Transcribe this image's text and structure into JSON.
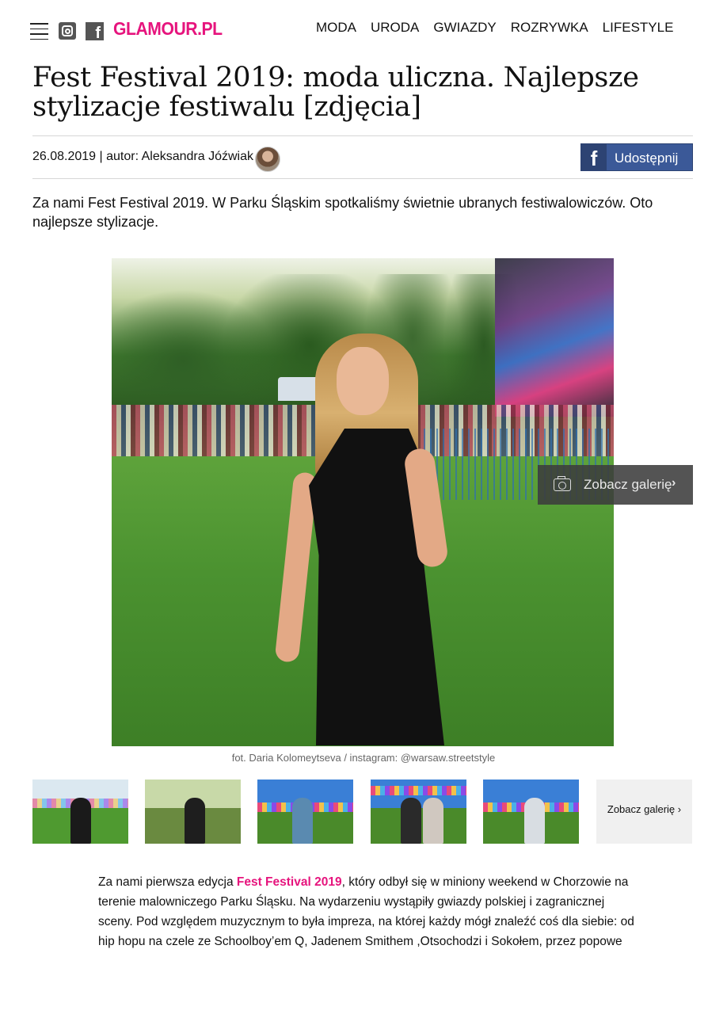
{
  "header": {
    "logo": "GLAMOUR.PL",
    "nav": [
      "MODA",
      "URODA",
      "GWIAZDY",
      "ROZRYWKA",
      "LIFESTYLE"
    ],
    "icons": [
      "menu-icon",
      "instagram-icon",
      "facebook-icon"
    ]
  },
  "article": {
    "title": "Fest Festival 2019: moda uliczna. Najlepsze stylizacje festiwalu [zdjęcia]",
    "meta": "26.08.2019 | autor: Aleksandra Jóźwiak",
    "share_label": "Udostępnij",
    "lead": "Za nami Fest Festival 2019. W Parku Śląskim spotkaliśmy świetnie ubranych festiwalowiczów. Oto najlepsze stylizacje.",
    "gallery_button": "Zobacz galerię",
    "caption": "fot. Daria Kolomeytseva / instagram: @warsaw.streetstyle",
    "thumbs_more": "Zobacz galerię",
    "body": {
      "before": "Za nami pierwsza edycja ",
      "link": "Fest Festival 2019",
      "after": ", który odbył się w miniony weekend w Chorzowie na terenie malowniczego Parku Śląsku. Na wydarzeniu wystąpiły gwiazdy polskiej i zagranicznej sceny. Pod względem muzycznym to była impreza, na której każdy mógł znaleźć coś dla siebie: od hip hopu na czele ze Schoolboy’em Q, Jadenem Smithem ,Otsochodzi i Sokołem, przez popowe"
    }
  },
  "colors": {
    "brand": "#e6147d",
    "facebook": "#3b5998"
  }
}
